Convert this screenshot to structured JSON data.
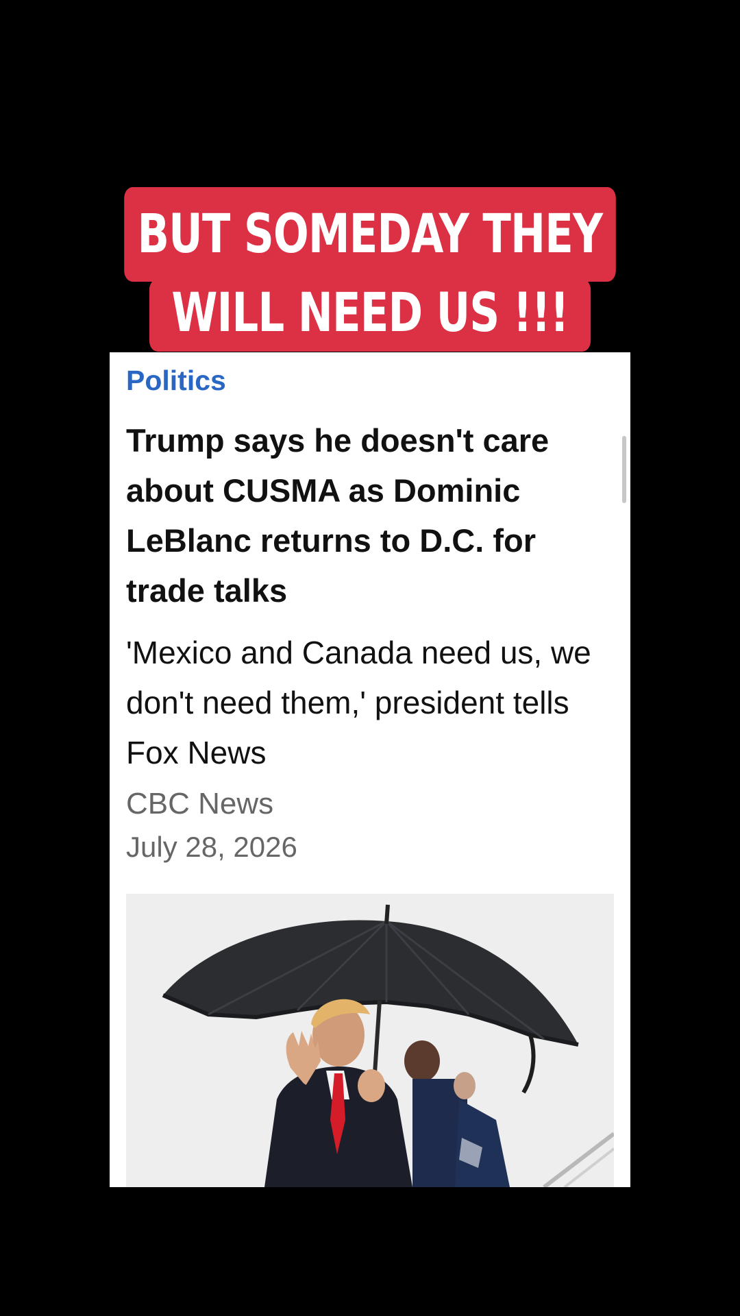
{
  "overlay_caption": {
    "line1": "BUT SOMEDAY THEY",
    "line2": "WILL NEED US !!!",
    "background_color": "#dc3045"
  },
  "article": {
    "category": "Politics",
    "headline": "Trump says he doesn't care about CUSMA as Dominic LeBlanc returns to D.C. for trade talks",
    "subheadline": "'Mexico and Canada need us, we don't need them,' president tells Fox News",
    "source": "CBC News",
    "date": "July 28, 2026",
    "category_color": "#2a66c4"
  }
}
